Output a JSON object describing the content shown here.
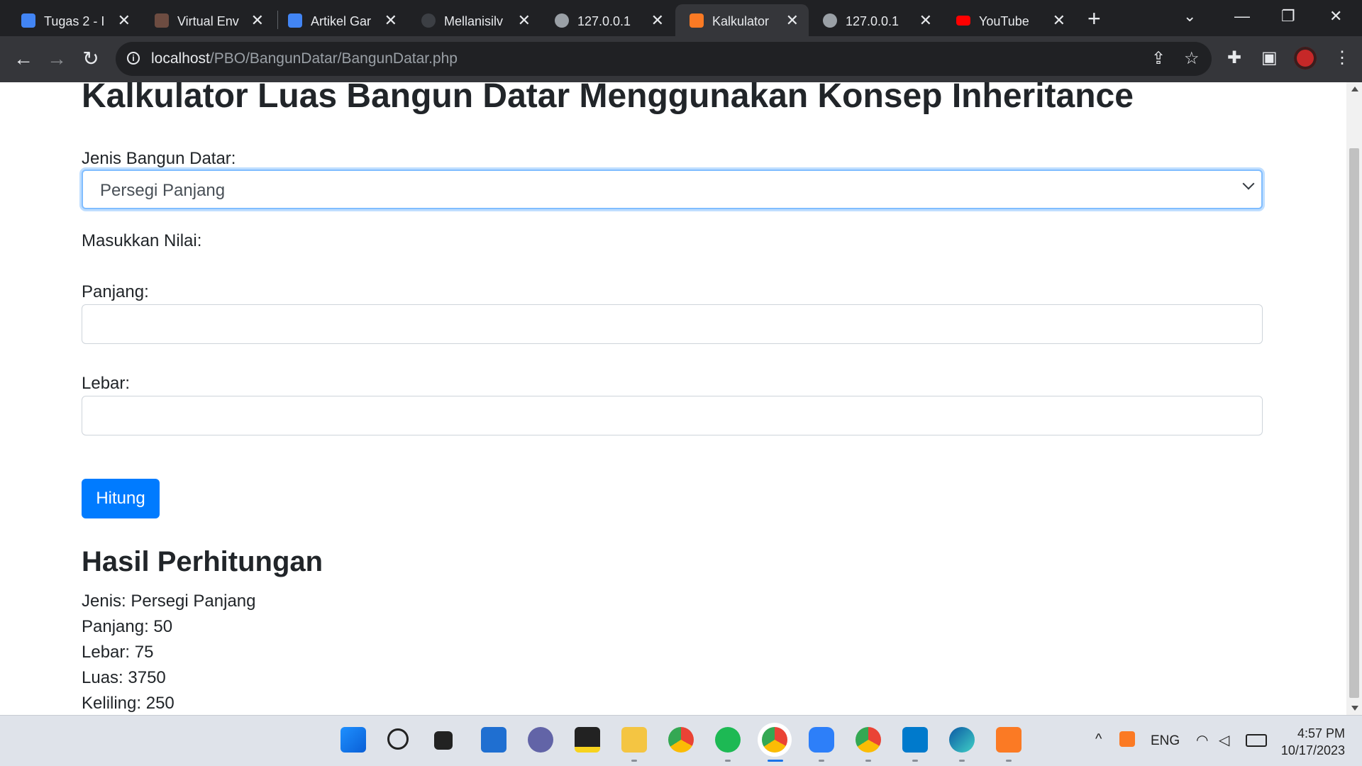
{
  "browser": {
    "tabs": [
      {
        "title": "Tugas 2 - I",
        "icon": "classroom-icon",
        "color": "#4285f4"
      },
      {
        "title": "Virtual Env",
        "icon": "avatar-icon",
        "color": "#6d4c41"
      },
      {
        "title": "Artikel Gar",
        "icon": "docs-icon",
        "color": "#4285f4"
      },
      {
        "title": "Mellanisilv",
        "icon": "github-icon",
        "color": "#24292e"
      },
      {
        "title": "127.0.0.1",
        "icon": "globe-icon",
        "color": "#9aa0a6"
      },
      {
        "title": "Kalkulator",
        "icon": "xampp-icon",
        "color": "#fb7a24",
        "active": true
      },
      {
        "title": "127.0.0.1",
        "icon": "globe-icon",
        "color": "#9aa0a6"
      },
      {
        "title": "YouTube",
        "icon": "youtube-icon",
        "color": "#ff0000"
      }
    ],
    "url_host": "localhost",
    "url_path": "/PBO/BangunDatar/BangunDatar.php"
  },
  "page": {
    "title": "Kalkulator Luas Bangun Datar Menggunakan Konsep Inheritance",
    "jenis_label": "Jenis Bangun Datar:",
    "jenis_value": "Persegi Panjang",
    "masukkan_label": "Masukkan Nilai:",
    "panjang_label": "Panjang:",
    "panjang_value": "",
    "lebar_label": "Lebar:",
    "lebar_value": "",
    "button_label": "Hitung",
    "accent_color": "#007bff"
  },
  "result": {
    "title": "Hasil Perhitungan",
    "jenis": "Jenis: Persegi Panjang",
    "panjang": "Panjang: 50",
    "lebar": "Lebar: 75",
    "luas": "Luas: 3750",
    "keliling": "Keliling: 250"
  },
  "taskbar": {
    "apps": [
      "windows-start-icon",
      "search-icon",
      "task-view-icon",
      "widgets-icon",
      "teams-chat-icon",
      "sticky-notes-icon",
      "file-explorer-icon",
      "chrome-icon",
      "spotify-icon",
      "chrome-profile-icon",
      "dev-app-icon",
      "chrome-profile-p-icon",
      "vscode-icon",
      "edge-icon",
      "xampp-icon"
    ],
    "language": "ENG",
    "time": "4:57 PM",
    "date": "10/17/2023"
  }
}
